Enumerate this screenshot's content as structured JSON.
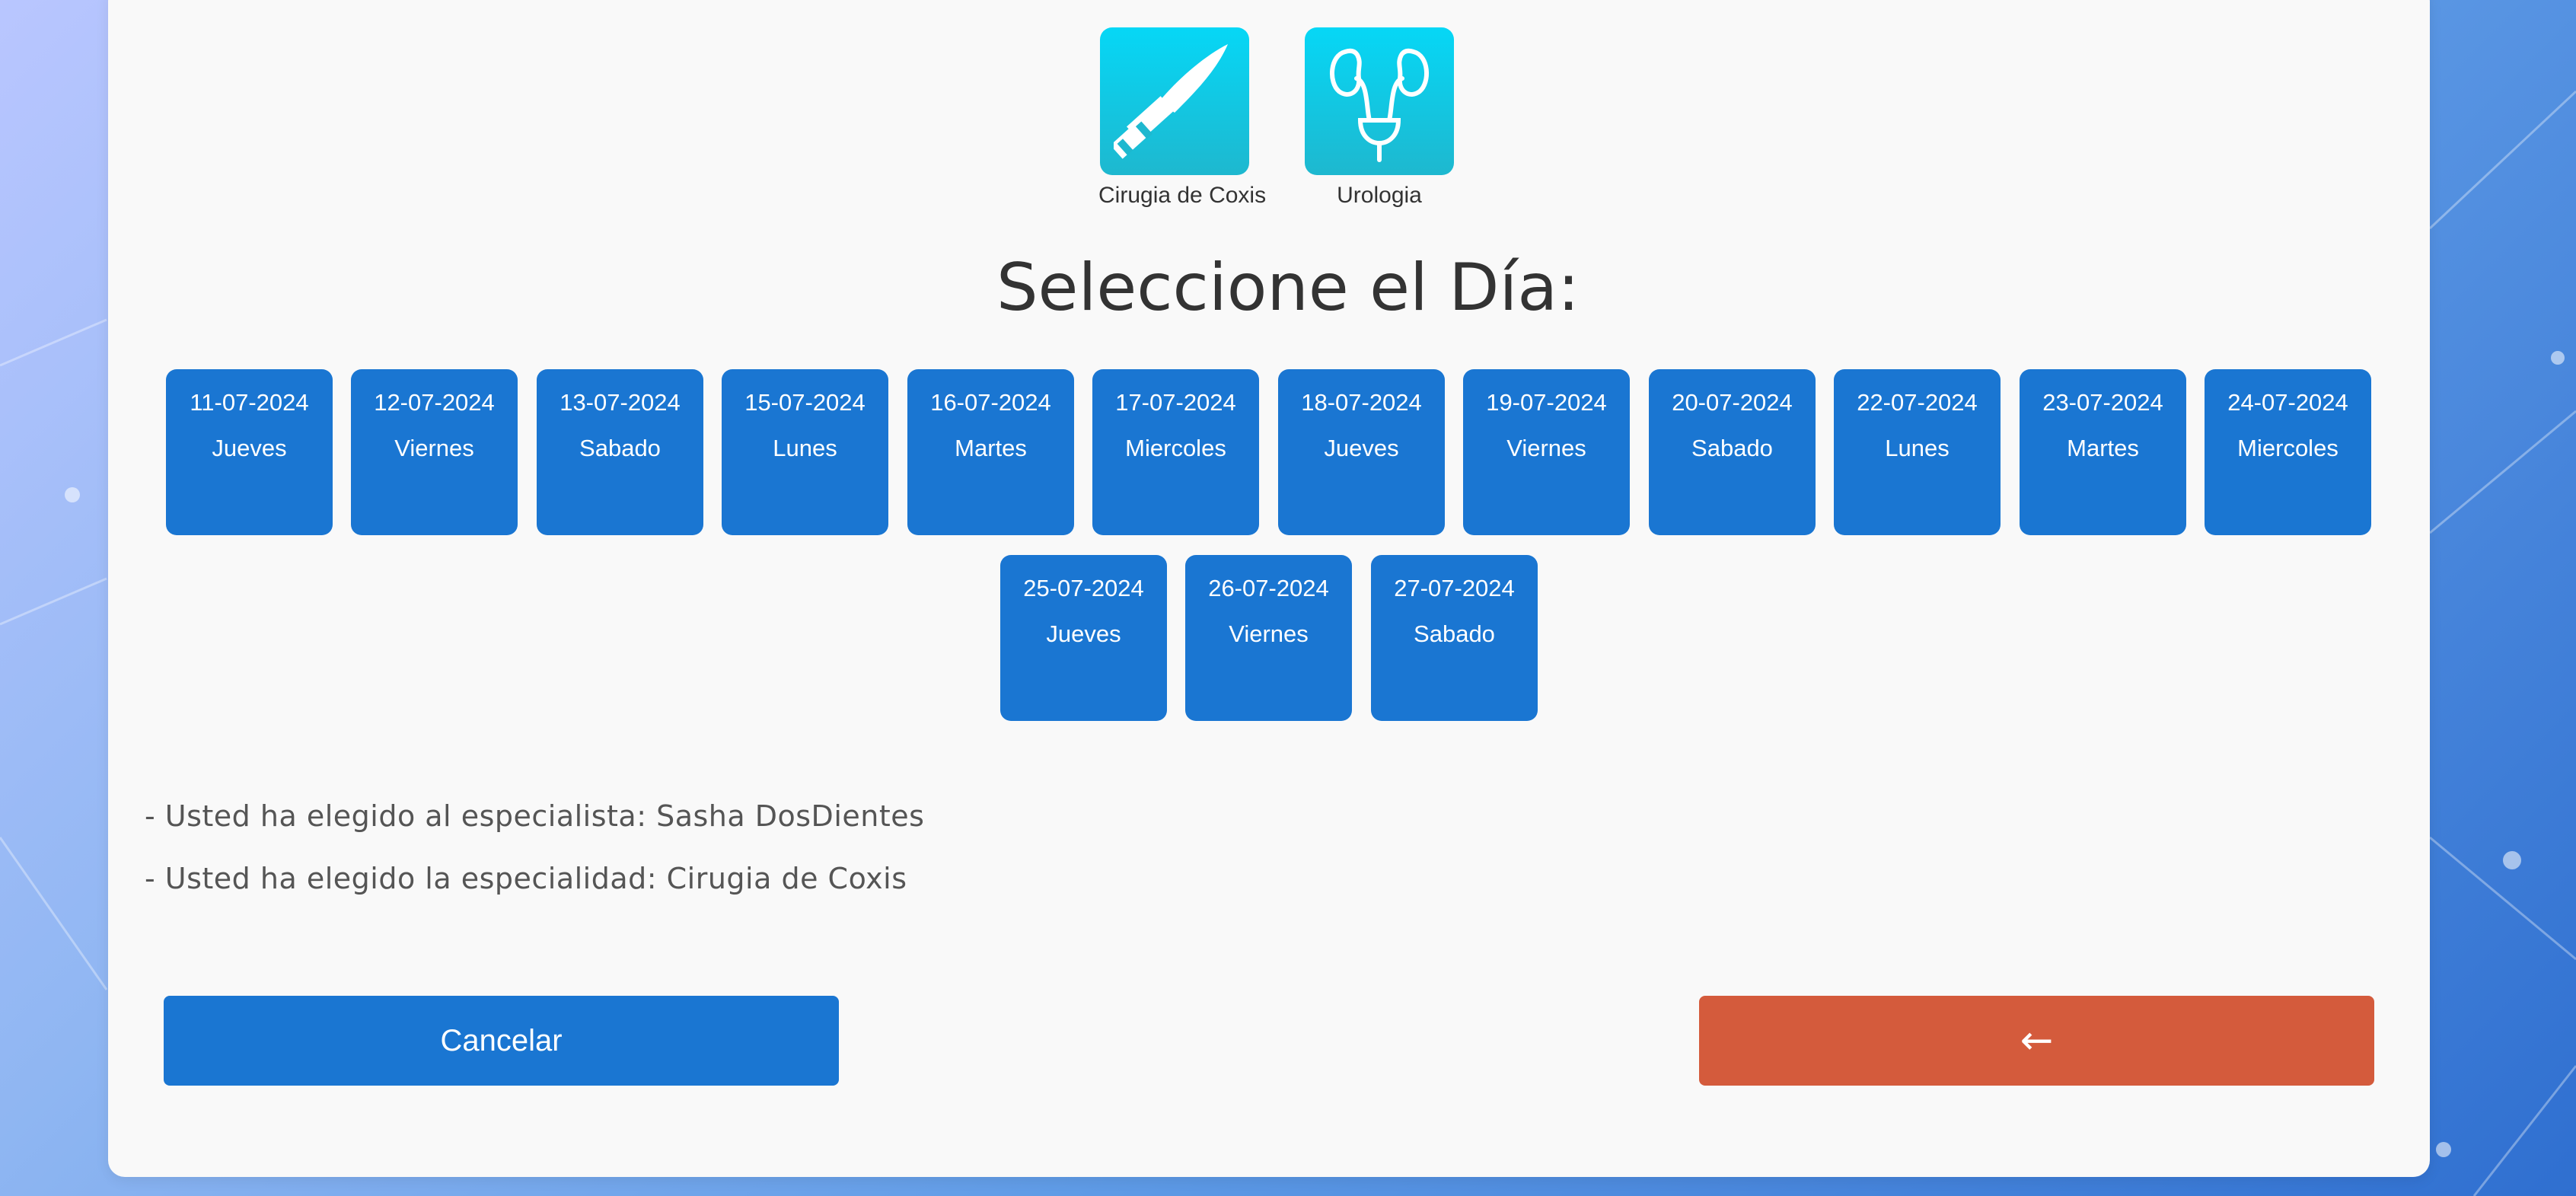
{
  "specialties": [
    {
      "label": "Cirugia de Coxis",
      "icon": "scalpel-icon"
    },
    {
      "label": "Urologia",
      "icon": "kidneys-bladder-icon"
    }
  ],
  "title": "Seleccione el Día:",
  "days": [
    {
      "date": "11-07-2024",
      "weekday": "Jueves"
    },
    {
      "date": "12-07-2024",
      "weekday": "Viernes"
    },
    {
      "date": "13-07-2024",
      "weekday": "Sabado"
    },
    {
      "date": "15-07-2024",
      "weekday": "Lunes"
    },
    {
      "date": "16-07-2024",
      "weekday": "Martes"
    },
    {
      "date": "17-07-2024",
      "weekday": "Miercoles"
    },
    {
      "date": "18-07-2024",
      "weekday": "Jueves"
    },
    {
      "date": "19-07-2024",
      "weekday": "Viernes"
    },
    {
      "date": "20-07-2024",
      "weekday": "Sabado"
    },
    {
      "date": "22-07-2024",
      "weekday": "Lunes"
    },
    {
      "date": "23-07-2024",
      "weekday": "Martes"
    },
    {
      "date": "24-07-2024",
      "weekday": "Miercoles"
    },
    {
      "date": "25-07-2024",
      "weekday": "Jueves"
    },
    {
      "date": "26-07-2024",
      "weekday": "Viernes"
    },
    {
      "date": "27-07-2024",
      "weekday": "Sabado"
    }
  ],
  "info": {
    "specialist": "- Usted ha elegido al especialista: Sasha DosDientes",
    "specialty": "- Usted ha elegido la especialidad: Cirugia de Coxis"
  },
  "buttons": {
    "cancel": "Cancelar",
    "back_icon": "←"
  },
  "colors": {
    "primary": "#1a76d2",
    "back_button": "#d45b3c",
    "tile_gradient_top": "#06d7f6",
    "tile_gradient_bottom": "#1eb8cf"
  }
}
